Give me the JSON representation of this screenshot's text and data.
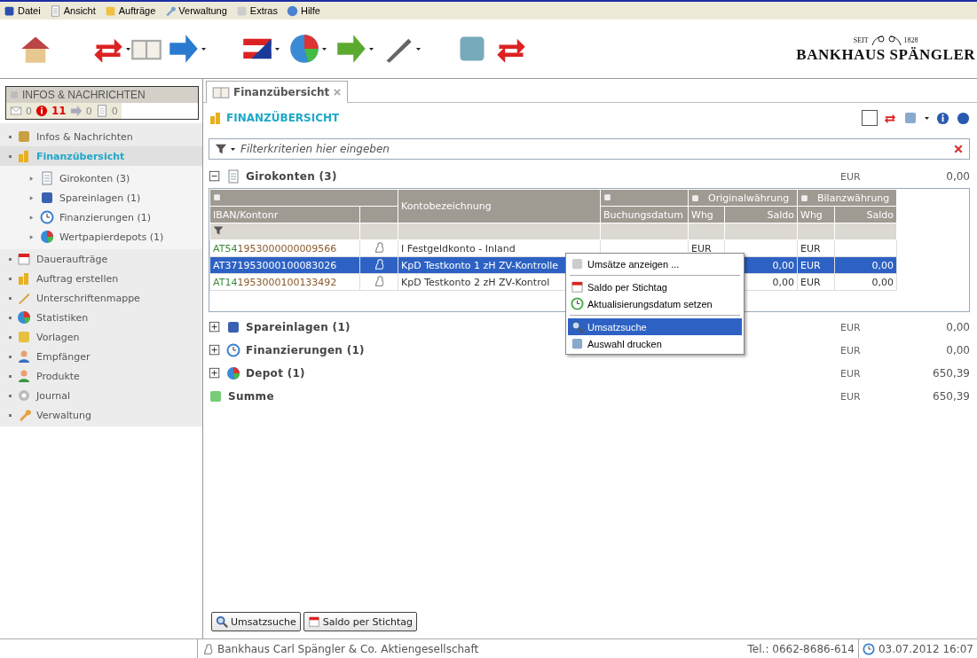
{
  "menu_bar": [
    {
      "label": "Datei"
    },
    {
      "label": "Ansicht"
    },
    {
      "label": "Aufträge"
    },
    {
      "label": "Verwaltung"
    },
    {
      "label": "Extras"
    },
    {
      "label": "Hilfe"
    }
  ],
  "toolbar": [
    {
      "dropdown": false
    },
    {
      "dropdown": true
    },
    {
      "dropdown": false
    },
    {
      "dropdown": true
    },
    {
      "dropdown": true
    },
    {
      "dropdown": true
    },
    {
      "dropdown": true
    },
    {
      "dropdown": true
    },
    {
      "dropdown": false
    },
    {
      "dropdown": false
    }
  ],
  "logo": {
    "since": "SEIT",
    "year": "1828",
    "name": "BANKHAUS SPÄNGLER"
  },
  "sidebar": {
    "header": "INFOS & NACHRICHTEN",
    "counters": [
      {
        "count": "0",
        "alert": false
      },
      {
        "count": "11",
        "alert": true
      },
      {
        "count": "0",
        "alert": false
      },
      {
        "count": "0",
        "alert": false
      }
    ],
    "items": [
      {
        "label": "Infos & Nachrichten",
        "selected": false
      },
      {
        "label": "Finanzübersicht",
        "selected": true,
        "children": [
          {
            "label": "Girokonten (3)"
          },
          {
            "label": "Spareinlagen (1)"
          },
          {
            "label": "Finanzierungen (1)"
          },
          {
            "label": "Wertpapierdepots (1)"
          }
        ]
      },
      {
        "label": "Daueraufträge",
        "selected": false
      },
      {
        "label": "Auftrag erstellen",
        "selected": false
      },
      {
        "label": "Unterschriftenmappe",
        "selected": false
      },
      {
        "label": "Statistiken",
        "selected": false
      },
      {
        "label": "Vorlagen",
        "selected": false
      },
      {
        "label": "Empfänger",
        "selected": false
      },
      {
        "label": "Produkte",
        "selected": false
      },
      {
        "label": "Journal",
        "selected": false
      },
      {
        "label": "Verwaltung",
        "selected": false
      }
    ]
  },
  "tabs": [
    {
      "label": "Finanzübersicht",
      "selected": true
    }
  ],
  "page_title": "FINANZÜBERSICHT",
  "filter": {
    "placeholder": "Filterkriterien hier eingeben"
  },
  "groups": [
    {
      "kind": "group",
      "label": "Girokonten (3)",
      "expanded": true,
      "currency": "EUR",
      "amount": "0,00",
      "table": {
        "header_groups": [
          "Originalwährung",
          "Bilanzwährung"
        ],
        "columns": [
          "IBAN/Kontonr",
          "Kontobezeichnung",
          "Buchungsdatum",
          "Whg",
          "Saldo",
          "Whg",
          "Saldo"
        ],
        "rows": [
          {
            "iban_prefix": "AT54",
            "iban": "1953000000009566",
            "name": "I Festgeldkonto - Inland",
            "date": "",
            "orig_currency": "EUR",
            "orig_balance": "",
            "bal_currency": "EUR",
            "bal_balance": "",
            "selected": false
          },
          {
            "iban_prefix": "AT37",
            "iban": "1953000100083026",
            "name": "KpD Testkonto 1 zH ZV-Kontrolle",
            "date": "",
            "orig_currency": "",
            "orig_balance": "0,00",
            "bal_currency": "EUR",
            "bal_balance": "0,00",
            "selected": true
          },
          {
            "iban_prefix": "AT14",
            "iban": "1953000100133492",
            "name": "KpD Testkonto 2 zH ZV-Kontrol",
            "date": "",
            "orig_currency": "",
            "orig_balance": "0,00",
            "bal_currency": "EUR",
            "bal_balance": "0,00",
            "selected": false
          }
        ]
      }
    },
    {
      "kind": "group",
      "label": "Spareinlagen (1)",
      "expanded": false,
      "currency": "EUR",
      "amount": "0,00"
    },
    {
      "kind": "group",
      "label": "Finanzierungen (1)",
      "expanded": false,
      "currency": "EUR",
      "amount": "0,00"
    },
    {
      "kind": "group",
      "label": "Depot (1)",
      "expanded": false,
      "currency": "EUR",
      "amount": "650,39"
    },
    {
      "kind": "total",
      "label": "Summe",
      "currency": "EUR",
      "amount": "650,39"
    }
  ],
  "context_menu": [
    {
      "kind": "item",
      "label": "Umsätze anzeigen ...",
      "selected": false
    },
    {
      "kind": "separator"
    },
    {
      "kind": "item",
      "label": "Saldo per Stichtag",
      "selected": false
    },
    {
      "kind": "item",
      "label": "Aktualisierungsdatum setzen",
      "selected": false
    },
    {
      "kind": "separator"
    },
    {
      "kind": "item",
      "label": "Umsatzsuche",
      "selected": true
    },
    {
      "kind": "item",
      "label": "Auswahl drucken",
      "selected": false
    }
  ],
  "bottom_buttons": [
    {
      "label": "Umsatzsuche"
    },
    {
      "label": "Saldo per Stichtag"
    }
  ],
  "status_bar": {
    "company": "Bankhaus Carl Spängler & Co. Aktiengesellschaft",
    "phone": "Tel.: 0662-8686-614",
    "datetime": "03.07.2012 16:07"
  }
}
